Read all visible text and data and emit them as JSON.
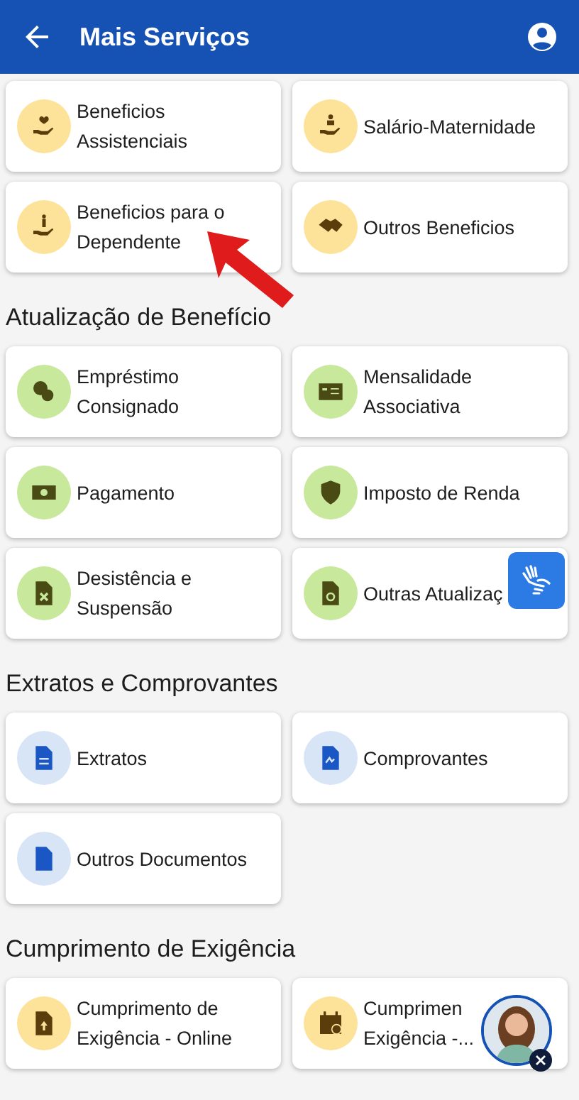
{
  "header": {
    "title": "Mais Serviços"
  },
  "sections": [
    {
      "color": "#fde39a",
      "cards": [
        {
          "lines": [
            "Beneficios",
            "Assistenciais"
          ]
        },
        {
          "lines": [
            "Salário-Maternidade"
          ]
        },
        {
          "lines": [
            "Beneficios para o",
            "Dependente"
          ]
        },
        {
          "lines": [
            "Outros Beneficios"
          ]
        }
      ]
    },
    {
      "title": "Atualização de Benefício",
      "color": "#c8e89c",
      "cards": [
        {
          "lines": [
            "Empréstimo",
            "Consignado"
          ]
        },
        {
          "lines": [
            "Mensalidade",
            "Associativa"
          ]
        },
        {
          "lines": [
            "Pagamento"
          ]
        },
        {
          "lines": [
            "Imposto de Renda"
          ]
        },
        {
          "lines": [
            "Desistência e",
            "Suspensão"
          ]
        },
        {
          "lines": [
            "Outras Atualizaç"
          ]
        }
      ]
    },
    {
      "title": "Extratos e Comprovantes",
      "color": "#d8e5f7",
      "cards": [
        {
          "lines": [
            "Extratos"
          ]
        },
        {
          "lines": [
            "Comprovantes"
          ]
        },
        {
          "lines": [
            "Outros Documentos"
          ]
        }
      ]
    },
    {
      "title": "Cumprimento de Exigência",
      "color": "#fde39a",
      "cards": [
        {
          "lines": [
            "Cumprimento de",
            "Exigência - Online"
          ]
        },
        {
          "lines": [
            "Cumprimen",
            "Exigência -..."
          ]
        }
      ]
    }
  ]
}
